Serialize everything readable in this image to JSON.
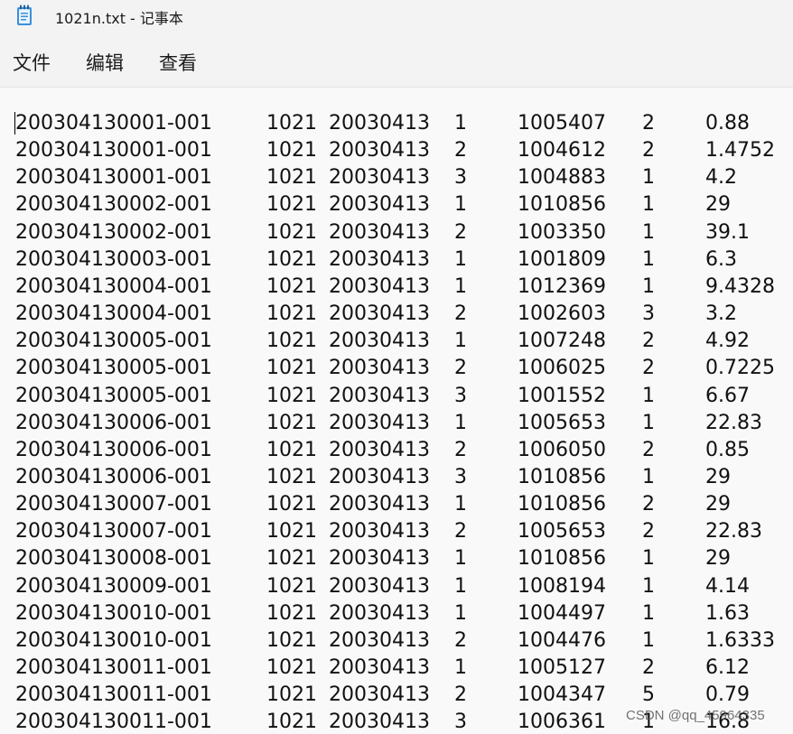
{
  "window": {
    "title": "1021n.txt - 记事本",
    "icon": "notepad-icon"
  },
  "menu": {
    "file": "文件",
    "edit": "编辑",
    "view": "查看"
  },
  "rows": [
    [
      "200304130001-001",
      "1021",
      "20030413",
      "1",
      "1005407",
      "2",
      "0.88"
    ],
    [
      "200304130001-001",
      "1021",
      "20030413",
      "2",
      "1004612",
      "2",
      "1.4752"
    ],
    [
      "200304130001-001",
      "1021",
      "20030413",
      "3",
      "1004883",
      "1",
      "4.2"
    ],
    [
      "200304130002-001",
      "1021",
      "20030413",
      "1",
      "1010856",
      "1",
      "29"
    ],
    [
      "200304130002-001",
      "1021",
      "20030413",
      "2",
      "1003350",
      "1",
      "39.1"
    ],
    [
      "200304130003-001",
      "1021",
      "20030413",
      "1",
      "1001809",
      "1",
      "6.3"
    ],
    [
      "200304130004-001",
      "1021",
      "20030413",
      "1",
      "1012369",
      "1",
      "9.4328"
    ],
    [
      "200304130004-001",
      "1021",
      "20030413",
      "2",
      "1002603",
      "3",
      "3.2"
    ],
    [
      "200304130005-001",
      "1021",
      "20030413",
      "1",
      "1007248",
      "2",
      "4.92"
    ],
    [
      "200304130005-001",
      "1021",
      "20030413",
      "2",
      "1006025",
      "2",
      "0.7225"
    ],
    [
      "200304130005-001",
      "1021",
      "20030413",
      "3",
      "1001552",
      "1",
      "6.67"
    ],
    [
      "200304130006-001",
      "1021",
      "20030413",
      "1",
      "1005653",
      "1",
      "22.83"
    ],
    [
      "200304130006-001",
      "1021",
      "20030413",
      "2",
      "1006050",
      "2",
      "0.85"
    ],
    [
      "200304130006-001",
      "1021",
      "20030413",
      "3",
      "1010856",
      "1",
      "29"
    ],
    [
      "200304130007-001",
      "1021",
      "20030413",
      "1",
      "1010856",
      "2",
      "29"
    ],
    [
      "200304130007-001",
      "1021",
      "20030413",
      "2",
      "1005653",
      "2",
      "22.83"
    ],
    [
      "200304130008-001",
      "1021",
      "20030413",
      "1",
      "1010856",
      "1",
      "29"
    ],
    [
      "200304130009-001",
      "1021",
      "20030413",
      "1",
      "1008194",
      "1",
      "4.14"
    ],
    [
      "200304130010-001",
      "1021",
      "20030413",
      "1",
      "1004497",
      "1",
      "1.63"
    ],
    [
      "200304130010-001",
      "1021",
      "20030413",
      "2",
      "1004476",
      "1",
      "1.6333"
    ],
    [
      "200304130011-001",
      "1021",
      "20030413",
      "1",
      "1005127",
      "2",
      "6.12"
    ],
    [
      "200304130011-001",
      "1021",
      "20030413",
      "2",
      "1004347",
      "5",
      "0.79"
    ],
    [
      "200304130011-001",
      "1021",
      "20030413",
      "3",
      "1006361",
      "1",
      "16.8"
    ]
  ],
  "watermark": "CSDN @qq_45964335"
}
